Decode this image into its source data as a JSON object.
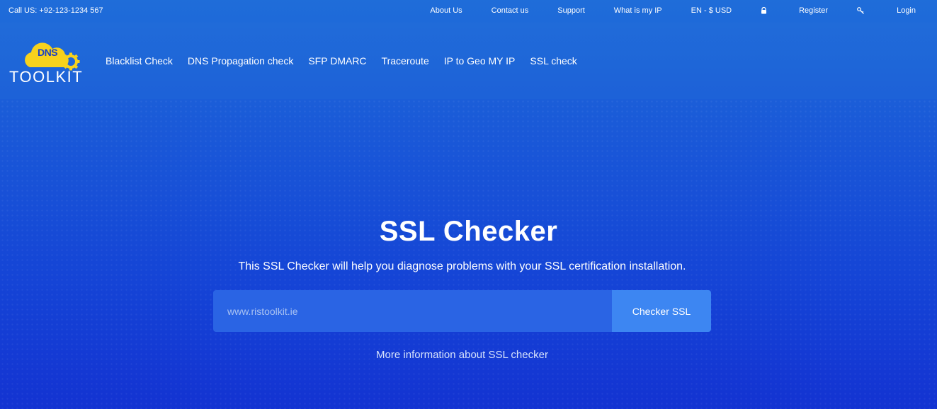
{
  "topbar": {
    "call": "Call US: +92-123-1234 567",
    "links": {
      "about": "About Us",
      "contact": "Contact us",
      "support": "Support",
      "whatismyip": "What is my IP",
      "locale": "EN - $ USD",
      "register": "Register",
      "login": "Login"
    },
    "icons": {
      "register": "lock-icon",
      "login": "key-icon"
    }
  },
  "logo": {
    "top_text": "DNS",
    "bottom_text": "TOOLKIT",
    "cloud_color": "#f7d21c"
  },
  "nav": {
    "items": [
      "Blacklist Check",
      "DNS Propagation check",
      "SFP DMARC",
      "Traceroute",
      "IP to Geo MY IP",
      "SSL check"
    ]
  },
  "hero": {
    "title": "SSL Checker",
    "subtitle": "This SSL Checker will help you diagnose problems with your SSL certification installation.",
    "input_placeholder": "www.ristoolkit.ie",
    "button_label": "Checker SSL",
    "more_link": "More information about SSL checker"
  },
  "colors": {
    "background_top": "#1f6dd9",
    "background_bottom": "#1333d2",
    "input_bg": "#2a64e4",
    "button_bg": "#3d86f2",
    "logo_yellow": "#f7d21c"
  }
}
